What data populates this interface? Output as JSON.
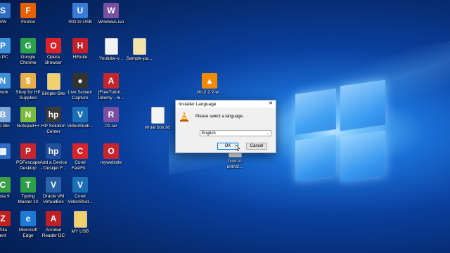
{
  "desktop": {
    "icons": [
      {
        "label": "SW",
        "color": "#2d6cc0",
        "glyph": "S"
      },
      {
        "label": "Firefox",
        "color": "#e66000",
        "glyph": "F"
      },
      {
        "label": "ISO to USB",
        "color": "#3a7bd5",
        "glyph": "U"
      },
      {
        "label": "Windows.iso",
        "color": "#7a4fa0",
        "glyph": "W"
      },
      {
        "label": "is PC",
        "color": "#3d8fd6",
        "glyph": "P"
      },
      {
        "label": "Google\nChrome",
        "color": "#2aa14a",
        "glyph": "G"
      },
      {
        "label": "Opera\nBrowser",
        "color": "#d9222a",
        "glyph": "O"
      },
      {
        "label": "HiSuite",
        "color": "#c2202a",
        "glyph": "H"
      },
      {
        "label": "Youtube-v...",
        "color": "#f2f2f2",
        "glyph": ""
      },
      {
        "label": "Sample-pa...",
        "color": "#f2e3a8",
        "glyph": ""
      },
      {
        "label": "twork",
        "color": "#3d8fd6",
        "glyph": "N"
      },
      {
        "label": "Shop for HP\nSupplies",
        "color": "#e8b04a",
        "glyph": "$"
      },
      {
        "label": "Simple-Site",
        "color": "#f2d06b",
        "glyph": ""
      },
      {
        "label": "Live Screen\nCapture",
        "color": "#333333",
        "glyph": "●"
      },
      {
        "label": "[FreeTutori...\nUdemy - re...",
        "color": "#c2272d",
        "glyph": "A"
      },
      {
        "label": "vlc-2.2.2-w...",
        "color": "#f08a00",
        "glyph": "▲"
      },
      {
        "label": "cle Bin",
        "color": "#7da7d9",
        "glyph": "B"
      },
      {
        "label": "Notepad++",
        "color": "#7dbb3c",
        "glyph": "N"
      },
      {
        "label": "HP Solution\nCenter",
        "color": "#3a3a3a",
        "glyph": "hp"
      },
      {
        "label": "VideoStudi...",
        "color": "#1b6fb5",
        "glyph": "V"
      },
      {
        "label": "01.rar",
        "color": "#7a4fa0",
        "glyph": "R"
      },
      {
        "label": "virual box.txt",
        "color": "#f4f4f4",
        "glyph": ""
      },
      {
        "label": "",
        "color": "#2d6cc0",
        "glyph": "▦"
      },
      {
        "label": "PDFescape\nDesktop",
        "color": "#c8242d",
        "glyph": "P"
      },
      {
        "label": "Add a Device\n- Deskjet F...",
        "color": "#1f4f99",
        "glyph": "hp"
      },
      {
        "label": "Corel\nFastFli...",
        "color": "#d5242b",
        "glyph": "C"
      },
      {
        "label": "mywebsite",
        "color": "#c8242d",
        "glyph": "O"
      },
      {
        "label": "how to\nuninst...",
        "color": "#f4f4f4",
        "glyph": ""
      },
      {
        "label": "tasia 9",
        "color": "#3ca049",
        "glyph": "C"
      },
      {
        "label": "Typing\nMaster 10",
        "color": "#2f9e47",
        "glyph": "T"
      },
      {
        "label": "Oracle VM\nVirtualBox",
        "color": "#2a62a8",
        "glyph": "V"
      },
      {
        "label": "Corel\nVideoStud...",
        "color": "#1b6fb5",
        "glyph": "V"
      },
      {
        "label": "Zilla\nent",
        "color": "#c0221f",
        "glyph": "Z"
      },
      {
        "label": "Microsoft\nEdge",
        "color": "#1f7ad6",
        "glyph": "e"
      },
      {
        "label": "Acrobat\nReader DC",
        "color": "#c01f24",
        "glyph": "A"
      },
      {
        "label": "MY USB",
        "color": "#f2d06b",
        "glyph": ""
      }
    ]
  },
  "dialog": {
    "title": "Installer Language",
    "close": "✕",
    "prompt": "Please select a language.",
    "selected_language": "English",
    "dropdown_arrow": "⌄",
    "ok_label": "OK",
    "cancel_label": "Cancel",
    "icon": "vlc-cone-icon"
  }
}
